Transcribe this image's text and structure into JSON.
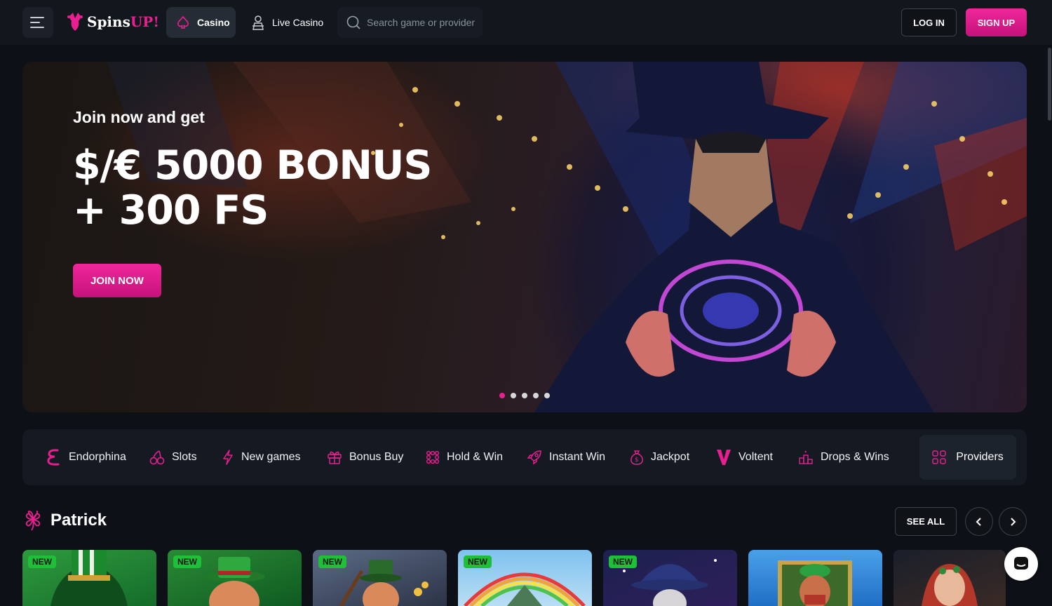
{
  "header": {
    "logo": {
      "text_main": "Spins",
      "text_accent": "UP!"
    },
    "nav_casino": "Casino",
    "nav_live_casino": "Live Casino",
    "search_placeholder": "Search game or provider",
    "login_label": "LOG IN",
    "signup_label": "SIGN UP"
  },
  "hero": {
    "subtitle": "Join now and get",
    "title_line1": "$/€ 5000 BONUS",
    "title_line2": "+ 300 FS",
    "cta_label": "JOIN NOW",
    "slides_count": 5,
    "active_slide": 1
  },
  "categories": [
    {
      "label": "Endorphina",
      "icon": "endorphina-icon"
    },
    {
      "label": "Slots",
      "icon": "cherries-icon"
    },
    {
      "label": "New games",
      "icon": "lightning-icon"
    },
    {
      "label": "Bonus Buy",
      "icon": "gift-icon"
    },
    {
      "label": "Hold & Win",
      "icon": "grid-dots-icon"
    },
    {
      "label": "Instant Win",
      "icon": "rocket-icon"
    },
    {
      "label": "Jackpot",
      "icon": "money-bag-icon"
    },
    {
      "label": "Voltent",
      "icon": "voltent-icon"
    },
    {
      "label": "Drops & Wins",
      "icon": "podium-icon"
    }
  ],
  "providers_label": "Providers",
  "section": {
    "title": "Patrick",
    "icon": "clover-icon",
    "see_all_label": "SEE ALL"
  },
  "games": [
    {
      "badge": "NEW"
    },
    {
      "badge": "NEW"
    },
    {
      "badge": "NEW"
    },
    {
      "badge": "NEW"
    },
    {
      "badge": "NEW"
    },
    {
      "badge": ""
    },
    {
      "badge": ""
    }
  ],
  "colors": {
    "accent": "#e8208f",
    "background": "#0d1117",
    "badge_new": "#1fbf3a"
  }
}
